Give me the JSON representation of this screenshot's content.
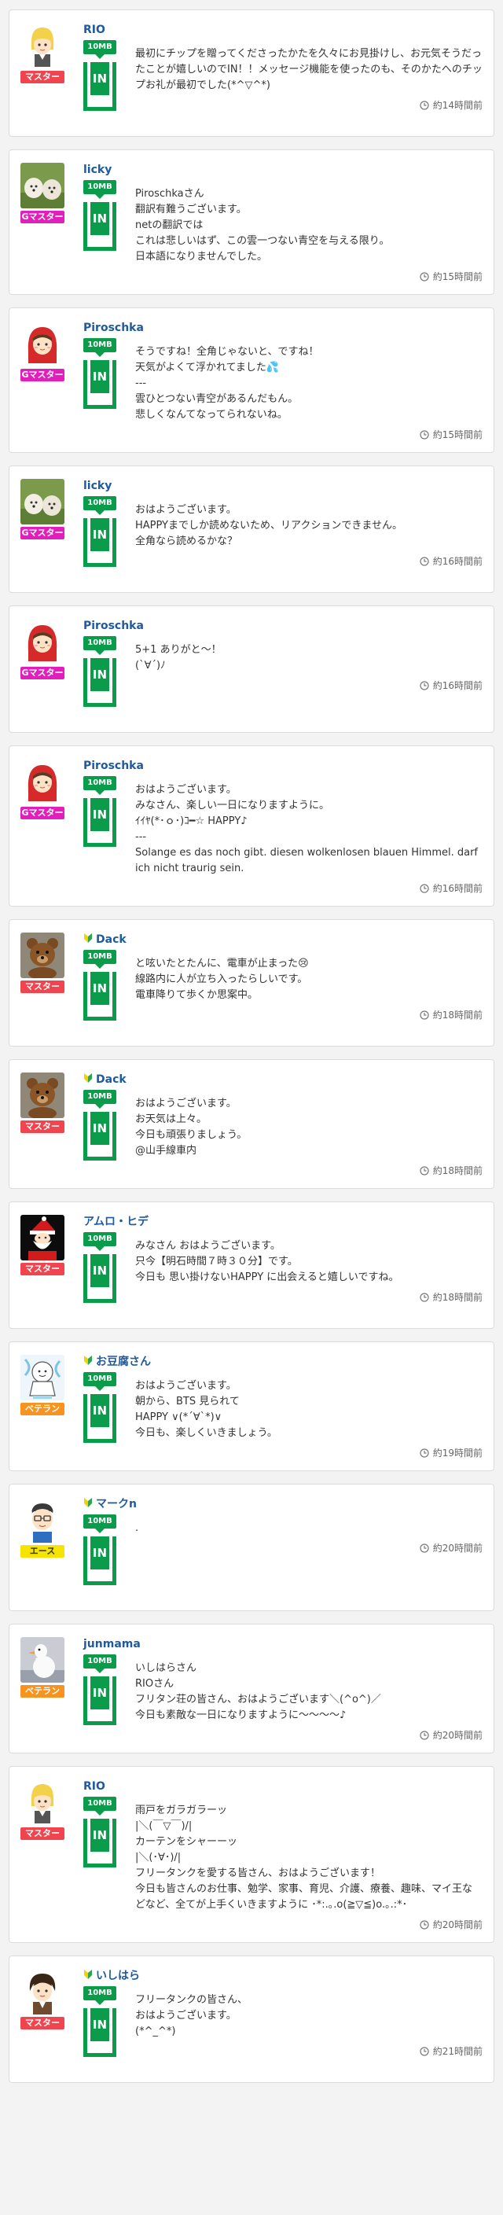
{
  "chip_badge_label": "10MB",
  "chip_in_label": "IN",
  "posts": [
    {
      "user": "RIO",
      "rank": "マスター",
      "rank_type": "master",
      "avatar": "rio",
      "leaf": false,
      "message": "最初にチップを贈ってくださったかたを久々にお見掛けし、お元気そうだったことが嬉しいのでIN！！メッセージ機能を使ったのも、そのかたへのチップお礼が最初でした(*^▽^*)",
      "time": "約14時間前"
    },
    {
      "user": "licky",
      "rank": "Gマスター",
      "rank_type": "gmaster",
      "avatar": "dogs",
      "leaf": false,
      "message": "Piroschkaさん\n翻訳有難うございます。\nnetの翻訳では\nこれは悲しいはず、この雲一つない青空を与える限り。\n日本語になりませんでした。",
      "time": "約15時間前"
    },
    {
      "user": "Piroschka",
      "rank": "Gマスター",
      "rank_type": "gmaster",
      "avatar": "hood",
      "leaf": false,
      "message": "そうですね！全角じゃないと、ですね！\n天気がよくて浮かれてました💦\n---\n雲ひとつない青空があるんだもん。\n悲しくなんてなってられないね。",
      "time": "約15時間前"
    },
    {
      "user": "licky",
      "rank": "Gマスター",
      "rank_type": "gmaster",
      "avatar": "dogs",
      "leaf": false,
      "message": "おはようございます。\nHAPPYまでしか読めないため、リアクションできません。\n全角なら読めるかな？",
      "time": "約16時間前"
    },
    {
      "user": "Piroschka",
      "rank": "Gマスター",
      "rank_type": "gmaster",
      "avatar": "hood",
      "leaf": false,
      "message": "5+1 ありがと～！\n(`∀´)ﾉ",
      "time": "約16時間前"
    },
    {
      "user": "Piroschka",
      "rank": "Gマスター",
      "rank_type": "gmaster",
      "avatar": "hood",
      "leaf": false,
      "message": "おはようございます。\nみなさん、楽しい一日になりますように。\nｲｲﾔ(*･ｏ･)ｺ━☆ HAPPY♪\n---\nSolange es das noch gibt. diesen wolkenlosen blauen Himmel. darf ich nicht traurig sein.",
      "time": "約16時間前"
    },
    {
      "user": "Dack",
      "rank": "マスター",
      "rank_type": "master",
      "avatar": "bear",
      "leaf": true,
      "message": "と呟いたとたんに、電車が止まった😢\n線路内に人が立ち入ったらしいです。\n電車降りて歩くか思案中。",
      "time": "約18時間前"
    },
    {
      "user": "Dack",
      "rank": "マスター",
      "rank_type": "master",
      "avatar": "bear",
      "leaf": true,
      "message": "おはようございます。\nお天気は上々。\n今日も頑張りましょう。\n@山手線車内",
      "time": "約18時間前"
    },
    {
      "user": "アムロ・ヒデ",
      "rank": "マスター",
      "rank_type": "master",
      "avatar": "santa",
      "leaf": false,
      "message": "みなさん おはようございます。\n只今【明石時間７時３０分】です。\n今日も 思い掛けないHAPPY に出会えると嬉しいですね。",
      "time": "約18時間前"
    },
    {
      "user": "お豆腐さん",
      "rank": "ベテラン",
      "rank_type": "veteran",
      "avatar": "teru",
      "leaf": true,
      "message": "おはようございます。\n朝から、BTS 見られて\nHAPPY ∨(*´∀`*)∨\n今日も、楽しくいきましょう。",
      "time": "約19時間前"
    },
    {
      "user": "マークn",
      "rank": "エース",
      "rank_type": "ace",
      "avatar": "glasses",
      "leaf": true,
      "message": ".",
      "time": "約20時間前"
    },
    {
      "user": "junmama",
      "rank": "ベテラン",
      "rank_type": "veteran",
      "avatar": "bird",
      "leaf": false,
      "message": "いしはらさん\nRIOさん\nフリタン荘の皆さん、おはようございます＼(^o^)／\n今日も素敵な一日になりますように〜〜〜〜♪",
      "time": "約20時間前"
    },
    {
      "user": "RIO",
      "rank": "マスター",
      "rank_type": "master",
      "avatar": "rio",
      "leaf": false,
      "message": "雨戸をガラガラーッ\n|＼(￣▽￣)/|\nカーテンをシャーーッ\n|＼(･∀･)/|\nフリータンクを愛する皆さん、おはようございます！\n今日も皆さんのお仕事、勉学、家事、育児、介護、療養、趣味、マイ王などなど、全てが上手くいきますように ･*:.｡.o(≧▽≦)o.｡.:*･",
      "time": "約20時間前"
    },
    {
      "user": "いしはら",
      "rank": "マスター",
      "rank_type": "master",
      "avatar": "boy",
      "leaf": true,
      "message": "フリータンクの皆さん、\nおはようございます。\n(*^_^*)",
      "time": "約21時間前"
    }
  ]
}
